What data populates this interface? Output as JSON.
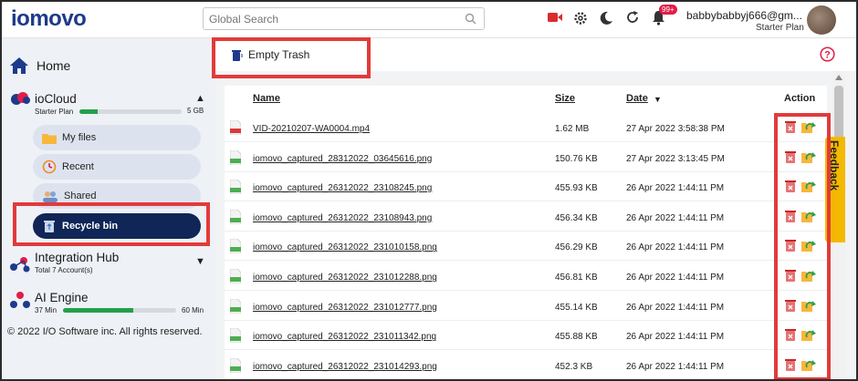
{
  "brand": {
    "logo_text": "iomovo"
  },
  "header": {
    "search": {
      "placeholder": "Global Search"
    },
    "notification_count": "99+",
    "user": {
      "email": "babbybabbyj666@gm...",
      "plan": "Starter Plan"
    }
  },
  "sidebar": {
    "home_label": "Home",
    "iocloud": {
      "title": "ioCloud",
      "plan": "Starter Plan",
      "storage_label": "5 GB",
      "storage_fraction": 0.18,
      "items": [
        {
          "label": "My files",
          "icon": "folder-icon"
        },
        {
          "label": "Recent",
          "icon": "clock-icon"
        },
        {
          "label": "Shared",
          "icon": "shared-icon"
        },
        {
          "label": "Recycle bin",
          "icon": "recycle-bin-icon",
          "active": true
        }
      ]
    },
    "integration_hub": {
      "title": "Integration Hub",
      "subtitle": "Total 7 Account(s)"
    },
    "ai_engine": {
      "title": "AI Engine",
      "used_label": "37 Min",
      "total_label": "60 Min",
      "usage_fraction": 0.62
    },
    "footer": "© 2022 I/O Software inc. All rights reserved."
  },
  "toolbar": {
    "empty_trash_label": "Empty Trash"
  },
  "feedback_label": "Feedback",
  "table": {
    "headers": {
      "name": "Name",
      "size": "Size",
      "date": "Date",
      "action": "Action"
    },
    "rows": [
      {
        "name": "VID-20210207-WA0004.mp4",
        "size": "1.62 MB",
        "date": "27 Apr 2022 3:58:38 PM",
        "type": "MP4"
      },
      {
        "name": "iomovo_captured_28312022_03645616.png",
        "size": "150.76 KB",
        "date": "27 Apr 2022 3:13:45 PM",
        "type": "PNG"
      },
      {
        "name": "iomovo_captured_26312022_23108245.png",
        "size": "455.93 KB",
        "date": "26 Apr 2022 1:44:11 PM",
        "type": "PNG"
      },
      {
        "name": "iomovo_captured_26312022_23108943.png",
        "size": "456.34 KB",
        "date": "26 Apr 2022 1:44:11 PM",
        "type": "PNG"
      },
      {
        "name": "iomovo_captured_26312022_231010158.png",
        "size": "456.29 KB",
        "date": "26 Apr 2022 1:44:11 PM",
        "type": "PNG"
      },
      {
        "name": "iomovo_captured_26312022_231012288.png",
        "size": "456.81 KB",
        "date": "26 Apr 2022 1:44:11 PM",
        "type": "PNG"
      },
      {
        "name": "iomovo_captured_26312022_231012777.png",
        "size": "455.14 KB",
        "date": "26 Apr 2022 1:44:11 PM",
        "type": "PNG"
      },
      {
        "name": "iomovo_captured_26312022_231011342.png",
        "size": "455.88 KB",
        "date": "26 Apr 2022 1:44:11 PM",
        "type": "PNG"
      },
      {
        "name": "iomovo_captured_26312022_231014293.png",
        "size": "452.3 KB",
        "date": "26 Apr 2022 1:44:11 PM",
        "type": "PNG"
      }
    ]
  },
  "colors": {
    "highlight": "#e23a3a",
    "active_nav": "#0f2656",
    "progress": "#22a04b",
    "feedback": "#f5b800"
  }
}
